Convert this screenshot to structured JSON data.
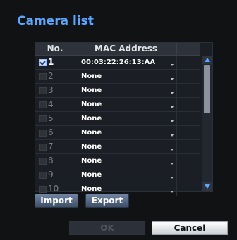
{
  "dialog": {
    "title": "Camera list"
  },
  "table": {
    "columns": [
      "No.",
      "MAC Address"
    ],
    "rows": [
      {
        "no": "1",
        "mac": "00:03:22:26:13:AA",
        "checked": true
      },
      {
        "no": "2",
        "mac": "None",
        "checked": false
      },
      {
        "no": "3",
        "mac": "None",
        "checked": false
      },
      {
        "no": "4",
        "mac": "None",
        "checked": false
      },
      {
        "no": "5",
        "mac": "None",
        "checked": false
      },
      {
        "no": "6",
        "mac": "None",
        "checked": false
      },
      {
        "no": "7",
        "mac": "None",
        "checked": false
      },
      {
        "no": "8",
        "mac": "None",
        "checked": false
      },
      {
        "no": "9",
        "mac": "None",
        "checked": false
      },
      {
        "no": "10",
        "mac": "None",
        "checked": false
      }
    ]
  },
  "actions": {
    "import_label": "Import",
    "export_label": "Export",
    "ok_label": "OK",
    "cancel_label": "Cancel"
  },
  "icons": {
    "scroll_up": "triangle-up-icon",
    "scroll_down": "triangle-down-icon",
    "dropdown": "chevron-down-icon",
    "checkbox": "checkbox-icon"
  },
  "colors": {
    "title": "#5aa7ff",
    "background": "#111214",
    "table_bg": "#1b1e24",
    "header_bg": "#2e323a",
    "scroll_arrow": "#5aa7ff"
  }
}
